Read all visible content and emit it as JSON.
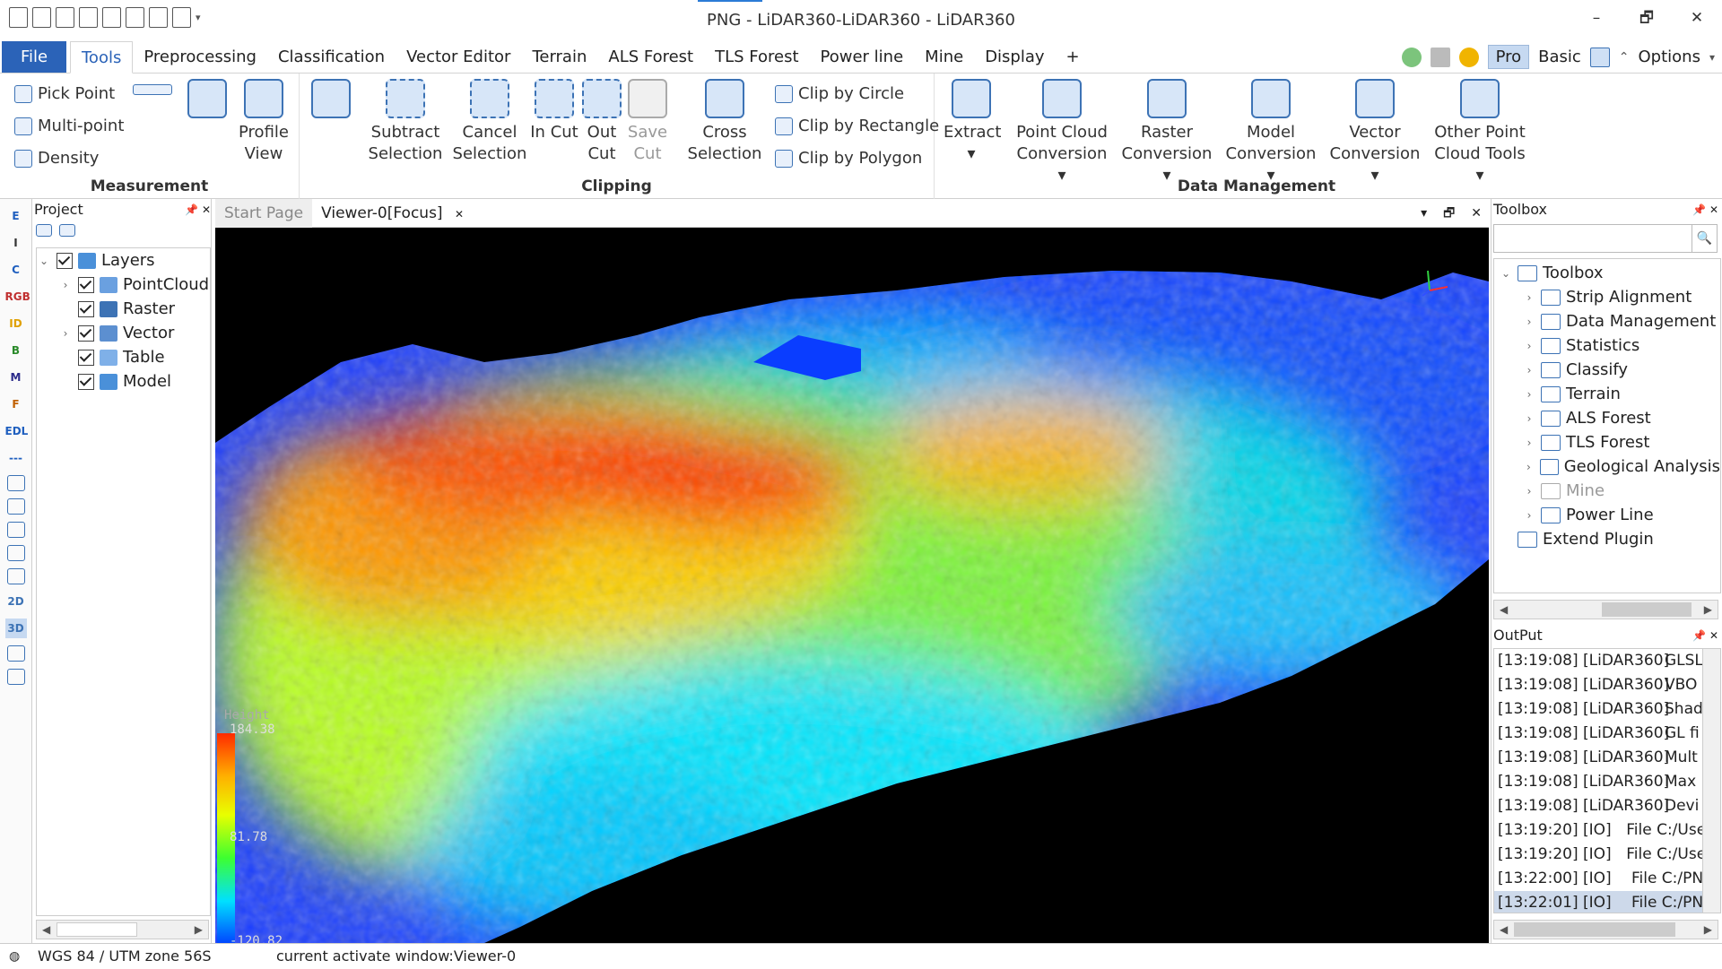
{
  "window": {
    "title": "PNG - LiDAR360-LiDAR360 - LiDAR360",
    "minimize": "–",
    "restore": "🗗",
    "close": "✕"
  },
  "menu": {
    "file": "File",
    "tabs": [
      "Tools",
      "Preprocessing",
      "Classification",
      "Vector Editor",
      "Terrain",
      "ALS Forest",
      "TLS Forest",
      "Power line",
      "Mine",
      "Display",
      "+"
    ],
    "active_tab": "Tools",
    "right": {
      "pro": "Pro",
      "basic": "Basic",
      "options": "Options",
      "options_arrow": "▾"
    }
  },
  "ribbon": {
    "measurement": {
      "title": "Measurement",
      "pick_point": "Pick Point",
      "multi_point": "Multi-point",
      "density": "Density",
      "profile_view": "Profile\nView"
    },
    "selection": {
      "subtract": "Subtract\nSelection",
      "cancel": "Cancel\nSelection"
    },
    "clipping": {
      "title": "Clipping",
      "in_cut": "In Cut",
      "out_cut": "Out\nCut",
      "save_cut": "Save\nCut",
      "cross_selection": "Cross\nSelection",
      "clip_circle": "Clip by Circle",
      "clip_rectangle": "Clip by Rectangle",
      "clip_polygon": "Clip by Polygon"
    },
    "data_management": {
      "title": "Data Management",
      "extract": "Extract\n▾",
      "point_cloud_conversion": "Point Cloud\nConversion ▾",
      "raster_conversion": "Raster\nConversion ▾",
      "model_conversion": "Model\nConversion ▾",
      "vector_conversion": "Vector\nConversion ▾",
      "other_point_cloud_tools": "Other Point\nCloud Tools ▾"
    }
  },
  "left_toolbar": [
    "E",
    "I",
    "C",
    "RGB",
    "ID",
    "B",
    "M",
    "F",
    "EDL",
    "---",
    "",
    "",
    "",
    "",
    "",
    "2D",
    "3D",
    "",
    ""
  ],
  "project": {
    "title": "Project",
    "pin": "📌",
    "close": "✕",
    "root": "Layers",
    "children": [
      "PointCloud",
      "Raster",
      "Vector",
      "Table",
      "Model"
    ]
  },
  "viewer": {
    "tabs": [
      "Start Page",
      "Viewer-0[Focus]"
    ],
    "tab_close": "✕",
    "controls": [
      "▾",
      "🗗",
      "✕"
    ],
    "legend": {
      "title": "Height",
      "max": "184.38",
      "mid": "81.78",
      "min": "-120.82"
    }
  },
  "toolbox": {
    "title": "Toolbox",
    "pin": "📌",
    "close": "✕",
    "search_placeholder": "",
    "search_icon": "🔍",
    "root": "Toolbox",
    "items": [
      {
        "label": "Strip Alignment",
        "disabled": false
      },
      {
        "label": "Data Management",
        "disabled": false
      },
      {
        "label": "Statistics",
        "disabled": false
      },
      {
        "label": "Classify",
        "disabled": false
      },
      {
        "label": "Terrain",
        "disabled": false
      },
      {
        "label": "ALS Forest",
        "disabled": false
      },
      {
        "label": "TLS Forest",
        "disabled": false
      },
      {
        "label": "Geological Analysis",
        "disabled": false
      },
      {
        "label": "Mine",
        "disabled": true
      },
      {
        "label": "Power Line",
        "disabled": false
      }
    ],
    "extend": "Extend Plugin"
  },
  "output": {
    "title": "OutPut",
    "pin": "📌",
    "close": "✕",
    "lines": [
      {
        "src": "[13:19:08] [LiDAR360]",
        "msg": "GLSL"
      },
      {
        "src": "[13:19:08] [LiDAR360]",
        "msg": "VBO"
      },
      {
        "src": "[13:19:08] [LiDAR360]",
        "msg": "Shad"
      },
      {
        "src": "[13:19:08] [LiDAR360]",
        "msg": "GL fi"
      },
      {
        "src": "[13:19:08] [LiDAR360]",
        "msg": "Mult"
      },
      {
        "src": "[13:19:08] [LiDAR360]",
        "msg": "Max"
      },
      {
        "src": "[13:19:08] [LiDAR360]",
        "msg": "Devi"
      },
      {
        "src": "[13:19:20] [IO]",
        "msg": "File C:/Users"
      },
      {
        "src": "[13:19:20] [IO]",
        "msg": "File C:/Users"
      },
      {
        "src": "[13:22:00] [IO]",
        "msg": "File C:/PNG/"
      },
      {
        "src": "[13:22:01] [IO]",
        "msg": "File C:/PNG/"
      }
    ]
  },
  "status": {
    "crs": "WGS 84 / UTM zone 56S",
    "message": "current activate window:Viewer-0"
  }
}
